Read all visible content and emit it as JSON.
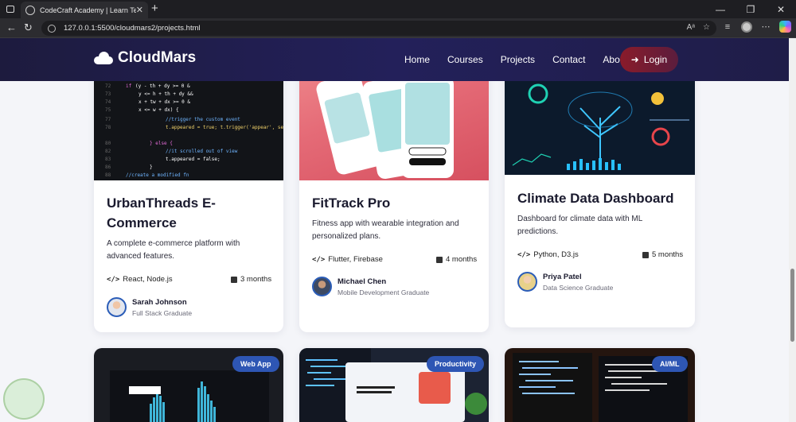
{
  "browser": {
    "tab_title": "CodeCraft Academy | Learn Tech Skills",
    "tab_close": "✕",
    "new_tab": "+",
    "url": "127.0.0.1:5500/cloudmars2/projects.html",
    "window_controls": [
      "—",
      "❐",
      "✕"
    ]
  },
  "header": {
    "brand": "CloudMars",
    "nav": [
      "Home",
      "Courses",
      "Projects",
      "Contact",
      "About"
    ],
    "login": "Login"
  },
  "projects": [
    {
      "title": "UrbanThreads E-Commerce",
      "description": "A complete e-commerce platform with advanced features.",
      "tech": "React, Node.js",
      "duration": "3 months",
      "author_name": "Sarah Johnson",
      "author_role": "Full Stack Graduate"
    },
    {
      "title": "FitTrack Pro",
      "description": "Fitness app with wearable integration and personalized plans.",
      "tech": "Flutter, Firebase",
      "duration": "4 months",
      "author_name": "Michael Chen",
      "author_role": "Mobile Development Graduate"
    },
    {
      "title": "Climate Data Dashboard",
      "description": "Dashboard for climate data with ML predictions.",
      "tech": "Python, D3.js",
      "duration": "5 months",
      "author_name": "Priya Patel",
      "author_role": "Data Science Graduate"
    }
  ],
  "next_row_badges": [
    "Web App",
    "Productivity",
    "AI/ML"
  ],
  "colors": {
    "header_bg": "#23205a",
    "login_bg": "#8a1b2a",
    "badge_bg": "#2e56b4",
    "card_bg": "#ffffff",
    "page_bg": "#f4f5f9"
  },
  "icons": {
    "tech": "code-icon",
    "duration": "calendar-icon",
    "login": "sign-in-icon",
    "brand": "cloud-icon"
  }
}
